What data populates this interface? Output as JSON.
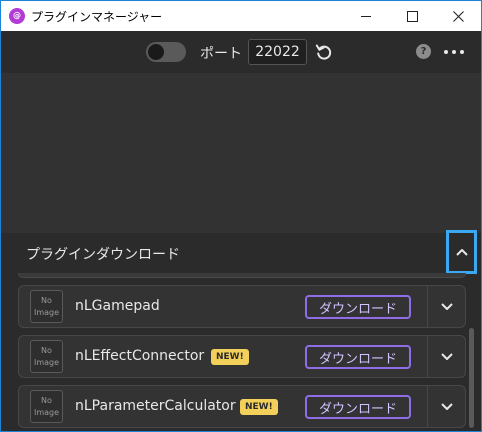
{
  "window": {
    "title": "プラグインマネージャー",
    "app_icon_glyph": "@"
  },
  "toolbar": {
    "port_label": "ポート",
    "port_value": "22022",
    "help_glyph": "?"
  },
  "section": {
    "title": "プラグインダウンロード"
  },
  "plugins": [
    {
      "no_image_line1": "No",
      "no_image_line2": "Image",
      "name": "nLGamepad",
      "badge": "",
      "download_label": "ダウンロード"
    },
    {
      "no_image_line1": "No",
      "no_image_line2": "Image",
      "name": "nLEffectConnector",
      "badge": "NEW!",
      "download_label": "ダウンロード"
    },
    {
      "no_image_line1": "No",
      "no_image_line2": "Image",
      "name": "nLParameterCalculator",
      "badge": "NEW!",
      "download_label": "ダウンロード"
    }
  ],
  "colors": {
    "accent_purple": "#8e6de6",
    "badge_yellow": "#f2d05a",
    "focus_blue": "#3aa8f2",
    "app_icon": "#b23bd6"
  }
}
